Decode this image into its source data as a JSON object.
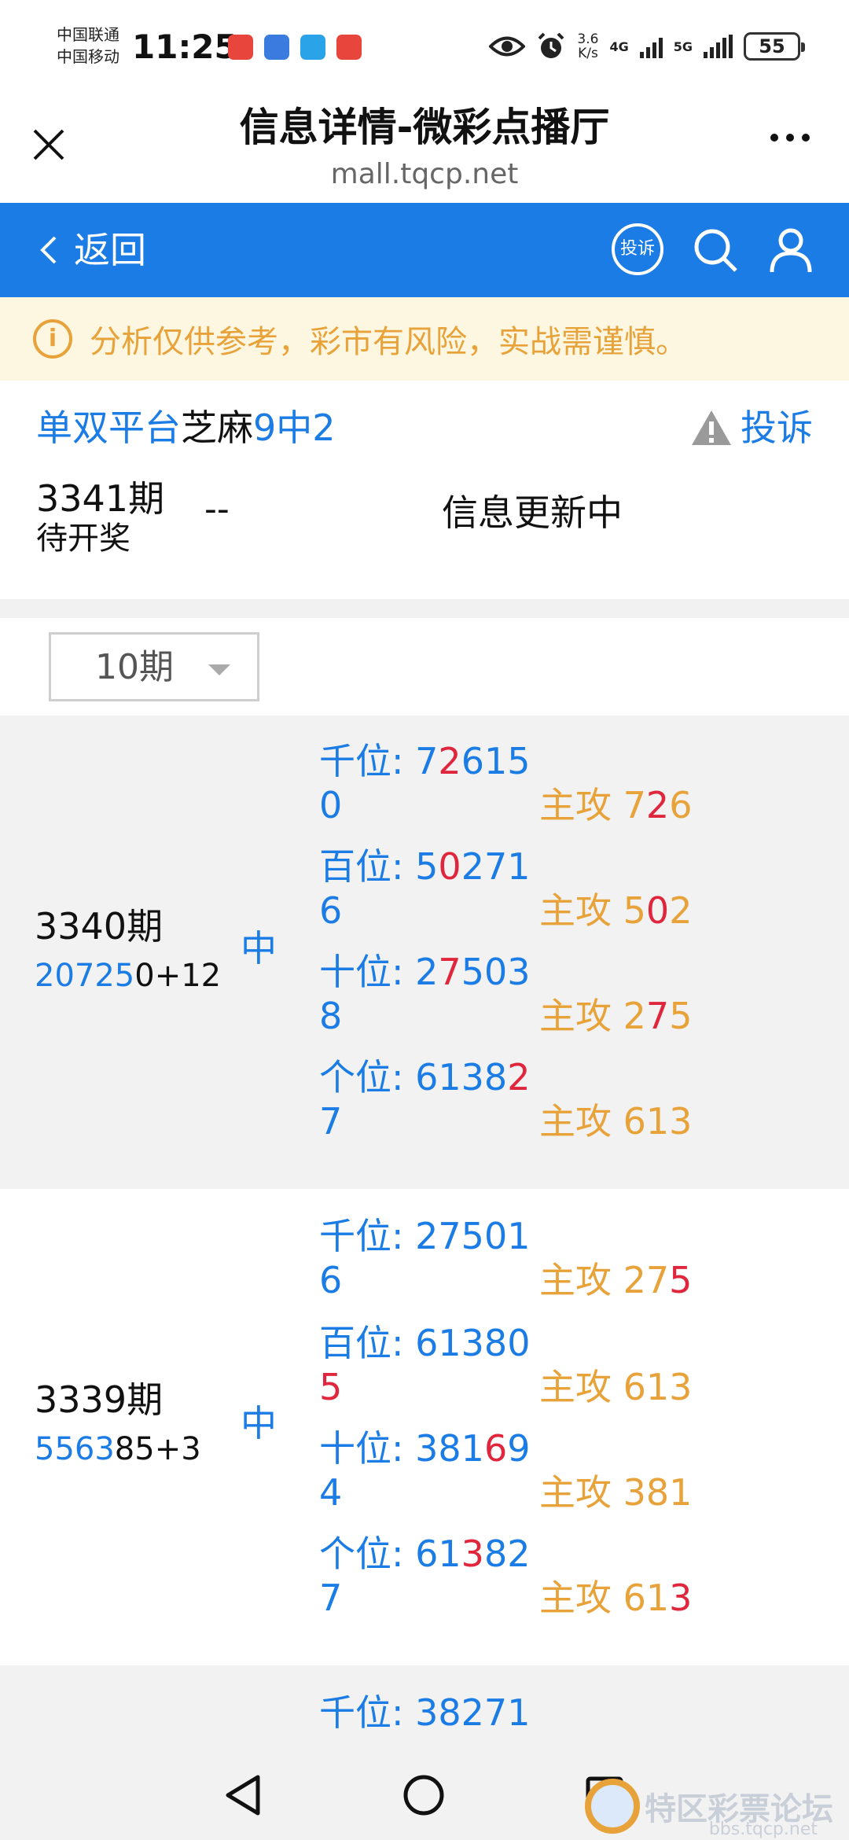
{
  "status_bar": {
    "carrier1": "中国联通",
    "carrier2": "中国移动",
    "time": "11:25",
    "speed": "3.6",
    "speed_unit": "K/s",
    "net1": "4G",
    "net2": "5G",
    "battery": "55"
  },
  "browser": {
    "title": "信息详情-微彩点播厅",
    "url": "mall.tqcp.net"
  },
  "header": {
    "back_label": "返回",
    "complain_icon_label": "投诉"
  },
  "notice": {
    "text": "分析仅供参考，彩市有风险，实战需谨慎。"
  },
  "plan": {
    "name_prefix": "单双平台",
    "name_mid": "芝麻",
    "name_suffix": "9中2",
    "report_label": "投诉",
    "current_period": "3341期",
    "current_status": "待开奖",
    "current_dash": "--",
    "current_info": "信息更新中"
  },
  "filter": {
    "selected": "10期"
  },
  "records": [
    {
      "period": "3340期",
      "nums_hit": "20725",
      "nums_rest": "0+12",
      "result": "中",
      "rows": [
        {
          "label": "千位: ",
          "pre": "7",
          "red": "2",
          "post": "615",
          "line2": "0",
          "atk_label": "主攻 ",
          "atk_pre": "7",
          "atk_red": "2",
          "atk_post": "6"
        },
        {
          "label": "百位: ",
          "pre": "5",
          "red": "0",
          "post": "271",
          "line2": "6",
          "atk_label": "主攻 ",
          "atk_pre": "5",
          "atk_red": "0",
          "atk_post": "2"
        },
        {
          "label": "十位: ",
          "pre": "2",
          "red": "7",
          "post": "503",
          "line2": "8",
          "atk_label": "主攻 ",
          "atk_pre": "2",
          "atk_red": "7",
          "atk_post": "5"
        },
        {
          "label": "个位: ",
          "pre": "6138",
          "red": "2",
          "post": "",
          "line2": "7",
          "atk_label": "主攻 ",
          "atk_pre": "613",
          "atk_red": "",
          "atk_post": ""
        }
      ]
    },
    {
      "period": "3339期",
      "nums_hit": "5563",
      "nums_rest": "85+3",
      "result": "中",
      "rows": [
        {
          "label": "千位: ",
          "pre": "275",
          "red": "",
          "post": "01",
          "line2": "6",
          "atk_label": "主攻 ",
          "atk_pre": "27",
          "atk_red": "5",
          "atk_post": ""
        },
        {
          "label": "百位: ",
          "pre": "61380",
          "red": "",
          "post": "",
          "line2_red": "5",
          "line2": "",
          "atk_label": "主攻 ",
          "atk_pre": "613",
          "atk_red": "",
          "atk_post": ""
        },
        {
          "label": "十位: ",
          "pre": "381",
          "red": "6",
          "post": "9",
          "line2": "4",
          "atk_label": "主攻 ",
          "atk_pre": "381",
          "atk_red": "",
          "atk_post": ""
        },
        {
          "label": "个位: ",
          "pre": "61",
          "red": "3",
          "post": "82",
          "line2": "7",
          "atk_label": "主攻 ",
          "atk_pre": "61",
          "atk_red": "3",
          "atk_post": ""
        }
      ]
    },
    {
      "rows": [
        {
          "label": "千位: ",
          "pre": "38271",
          "red": "",
          "post": "",
          "line2": "",
          "atk_label": "",
          "atk_pre": "",
          "atk_red": "",
          "atk_post": ""
        }
      ]
    }
  ],
  "forum": {
    "name": "特区彩票论坛",
    "sub": "bbs.tqcp.net"
  }
}
